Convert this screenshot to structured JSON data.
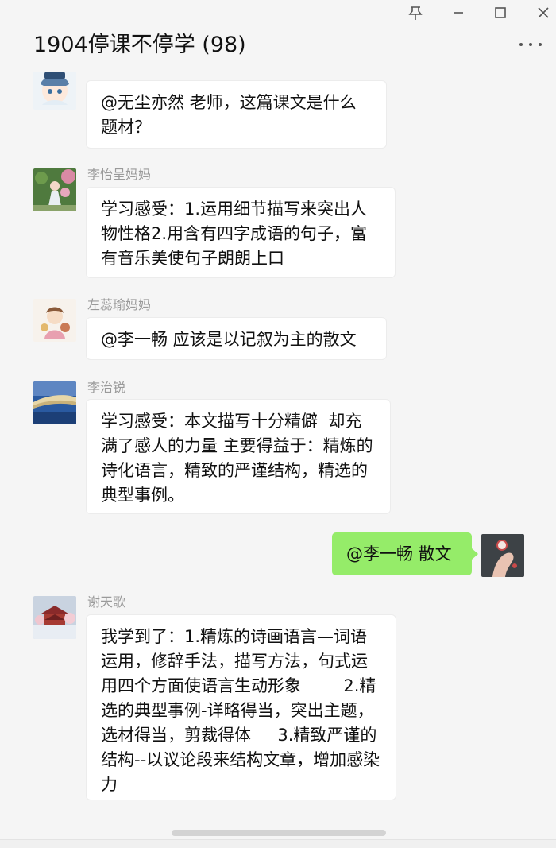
{
  "window": {
    "title": "1904停课不停学 (98)",
    "pin_icon": "pin-icon",
    "minimize_icon": "minimize-icon",
    "maximize_icon": "maximize-icon",
    "close_icon": "close-icon",
    "more_icon": "more-icon"
  },
  "messages": [
    {
      "sender": "",
      "text": "@无尘亦然 老师，这篇课文是什么题材？",
      "self": false,
      "avatar": "anime-character-avatar"
    },
    {
      "sender": "李怡呈妈妈",
      "text": "学习感受：1.运用细节描写来突出人物性格2.用含有四字成语的句子，富有音乐美使句子朗朗上口",
      "self": false,
      "avatar": "garden-photo-avatar"
    },
    {
      "sender": "左蕊瑜妈妈",
      "text": "@李一畅 应该是以记叙为主的散文",
      "self": false,
      "avatar": "cartoon-girl-avatar"
    },
    {
      "sender": "李治锐",
      "text": "学习感受：本文描写十分精僻  却充满了感人的力量 主要得益于：精炼的诗化语言，精致的严谨结构，精选的典型事例。",
      "self": false,
      "avatar": "landscape-avatar"
    },
    {
      "sender": "",
      "text": "@李一畅 散文",
      "self": true,
      "avatar": "hand-photo-avatar"
    },
    {
      "sender": "谢天歌",
      "text": "我学到了：1.精炼的诗画语言—词语运用，修辞手法，描写方法，句式运用四个方面使语言生动形象        2.精选的典型事例-详略得当，突出主题，选材得当，剪裁得体     3.精致严谨的结构--以议论段来结构文章，增加感染力",
      "self": false,
      "avatar": "pavilion-avatar"
    }
  ],
  "colors": {
    "self_bubble": "#95ec69",
    "other_bubble": "#ffffff",
    "background": "#f5f5f5"
  }
}
